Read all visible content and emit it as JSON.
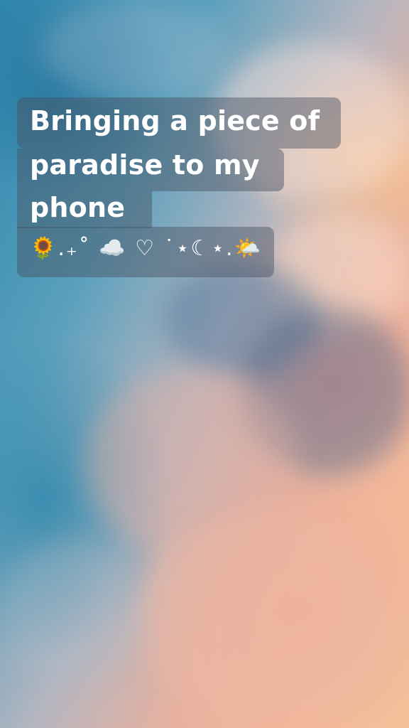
{
  "story": {
    "caption_lines": [
      "Bringing a piece of",
      "paradise to my",
      "phone"
    ],
    "emoji_line": "🌻.₊˚ ☁️ ♡ ˙⋆☾⋆.🌤️"
  },
  "background": {
    "subject": "sky with clouds at sunset",
    "colors": [
      "#2f86ad",
      "#f3c19a",
      "#e7a59a"
    ]
  }
}
